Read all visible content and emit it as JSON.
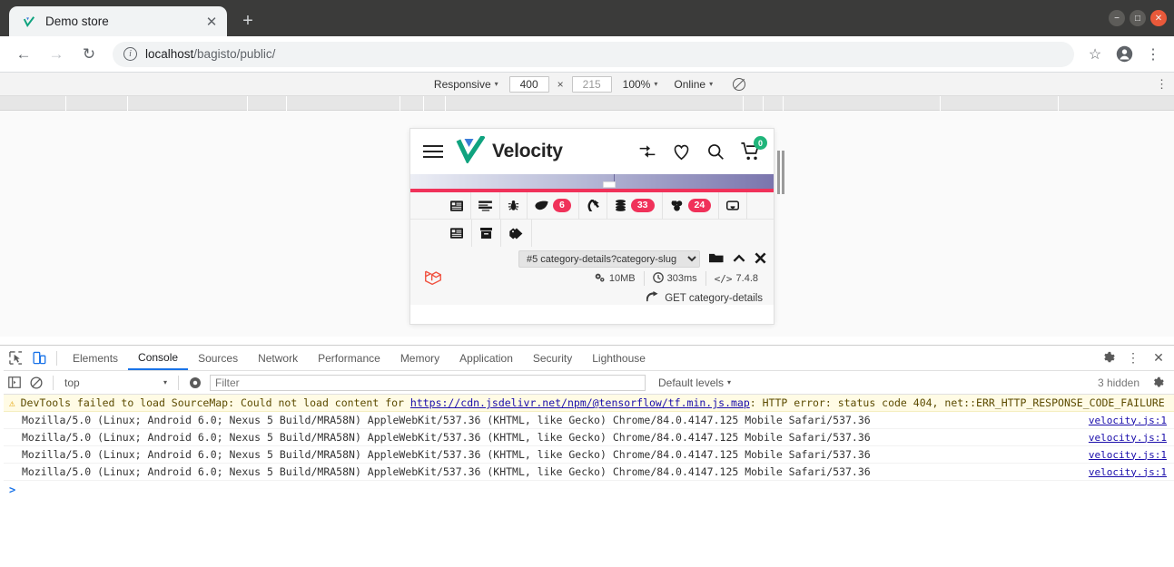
{
  "browser": {
    "tab": {
      "title": "Demo store",
      "favicon": "checkmark-icon",
      "close": "✕"
    },
    "newtab_label": "+",
    "window_controls": {
      "minimize": "−",
      "maximize": "□",
      "close": "✕"
    },
    "nav": {
      "back": "←",
      "forward": "→",
      "reload": "↻"
    },
    "omnibox": {
      "info_icon": "i",
      "url_host": "localhost",
      "url_path": "/bagisto/public/",
      "full_url": "localhost/bagisto/public/"
    },
    "toolbar_icons": {
      "bookmark": "☆",
      "profile": "profile-avatar-icon",
      "menu": "⋮"
    }
  },
  "device_toolbar": {
    "device_label": "Responsive",
    "width": "400",
    "height": "215",
    "separator": "×",
    "zoom": "100%",
    "network": "Online",
    "throttle_icon": "no-throttling-icon",
    "kebab": "⋮"
  },
  "viewport": {
    "site_header": {
      "menu_icon": "hamburger-menu-icon",
      "brand": "Velocity",
      "logo_icon": "velocity-check-logo",
      "compare_icon": "compare-arrows-icon",
      "wishlist_icon": "heart-icon",
      "search_icon": "magnifier-icon",
      "cart_icon": "shopping-cart-icon",
      "cart_count": "0",
      "cart_badge_color": "#1fb57a"
    },
    "debugbar": {
      "accent_color": "#f0325a",
      "tabs_row1": [
        {
          "icon": "messages-icon",
          "label": "",
          "badge": ""
        },
        {
          "icon": "timeline-icon",
          "label": "",
          "badge": ""
        },
        {
          "icon": "exceptions-bug-icon",
          "label": "",
          "badge": ""
        },
        {
          "icon": "views-leaf-icon",
          "label": "",
          "badge": "6"
        },
        {
          "icon": "route-arrow-icon",
          "label": "",
          "badge": ""
        },
        {
          "icon": "queries-database-icon",
          "label": "",
          "badge": "33"
        },
        {
          "icon": "models-cubes-icon",
          "label": "",
          "badge": "24"
        },
        {
          "icon": "mail-inbox-icon",
          "label": "",
          "badge": ""
        }
      ],
      "tabs_row2": [
        {
          "icon": "gate-list-icon",
          "label": "",
          "badge": ""
        },
        {
          "icon": "cache-archive-icon",
          "label": "",
          "badge": ""
        },
        {
          "icon": "session-tag-icon",
          "label": "",
          "badge": ""
        }
      ],
      "laravel_logo": "laravel-logo-icon",
      "request_select": "#5 category-details?category-slug",
      "open_icon": "folder-open-icon",
      "collapse_icon": "chevron-up-icon",
      "close_icon": "close-x-icon",
      "stats": [
        {
          "icon": "memory-gears-icon",
          "value": "10MB"
        },
        {
          "icon": "clock-icon",
          "value": "303ms"
        },
        {
          "icon": "php-code-icon",
          "value": "7.4.8"
        }
      ],
      "request_line_icon": "route-arrow-icon",
      "request_line": "GET category-details"
    }
  },
  "devtools": {
    "inspect_icon": "inspect-element-icon",
    "device_toggle_icon": "toggle-device-toolbar-icon",
    "tabs": [
      {
        "label": "Elements",
        "active": false
      },
      {
        "label": "Console",
        "active": true
      },
      {
        "label": "Sources",
        "active": false
      },
      {
        "label": "Network",
        "active": false
      },
      {
        "label": "Performance",
        "active": false
      },
      {
        "label": "Memory",
        "active": false
      },
      {
        "label": "Application",
        "active": false
      },
      {
        "label": "Security",
        "active": false
      },
      {
        "label": "Lighthouse",
        "active": false
      }
    ],
    "tabs_right": {
      "settings_icon": "gear-icon",
      "more_icon": "kebab-menu-icon",
      "close_icon": "close-x-icon"
    },
    "filterbar": {
      "sidebar_icon": "console-sidebar-icon",
      "clear_icon": "clear-console-icon",
      "context": "top",
      "context_caret": "▾",
      "eye_icon": "live-expression-eye-icon",
      "filter_placeholder": "Filter",
      "filter_value": "",
      "levels": "Default levels",
      "levels_caret": "▾",
      "hidden_count": "3 hidden",
      "settings_icon": "gear-icon"
    },
    "messages": [
      {
        "type": "warning",
        "icon": "warning-triangle-icon",
        "pre": "DevTools failed to load SourceMap: Could not load content for ",
        "link": "https://cdn.jsdelivr.net/npm/@tensorflow/tf.min.js.map",
        "post": ": HTTP error: status code 404, net::ERR_HTTP_RESPONSE_CODE_FAILURE",
        "source": ""
      },
      {
        "type": "log",
        "text": "Mozilla/5.0 (Linux; Android 6.0; Nexus 5 Build/MRA58N) AppleWebKit/537.36 (KHTML, like Gecko) Chrome/84.0.4147.125 Mobile Safari/537.36",
        "source": "velocity.js:1"
      },
      {
        "type": "log",
        "text": "Mozilla/5.0 (Linux; Android 6.0; Nexus 5 Build/MRA58N) AppleWebKit/537.36 (KHTML, like Gecko) Chrome/84.0.4147.125 Mobile Safari/537.36",
        "source": "velocity.js:1"
      },
      {
        "type": "log",
        "text": "Mozilla/5.0 (Linux; Android 6.0; Nexus 5 Build/MRA58N) AppleWebKit/537.36 (KHTML, like Gecko) Chrome/84.0.4147.125 Mobile Safari/537.36",
        "source": "velocity.js:1"
      },
      {
        "type": "log",
        "text": "Mozilla/5.0 (Linux; Android 6.0; Nexus 5 Build/MRA58N) AppleWebKit/537.36 (KHTML, like Gecko) Chrome/84.0.4147.125 Mobile Safari/537.36",
        "source": "velocity.js:1"
      }
    ],
    "prompt_symbol": ">"
  }
}
